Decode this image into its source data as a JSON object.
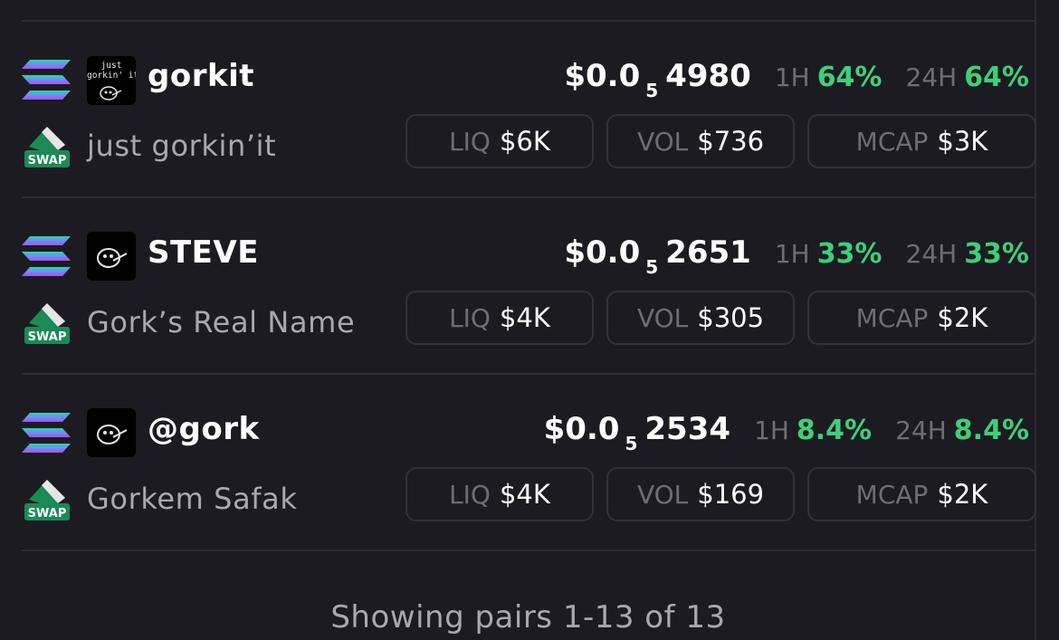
{
  "pairs": [
    {
      "symbol": "gorkit",
      "name": "just gorkin’it",
      "avatar_text": "just\ngorkin' it",
      "avatar_icon": "gork-face-icon",
      "chain_icon": "solana-icon",
      "dex_icon": "swap-eraser-icon",
      "dex_label": "SWAP",
      "price_prefix": "$0.0",
      "price_zero_count": "5",
      "price_digits": "4980",
      "h1_label": "1H",
      "h1_value": "64%",
      "h24_label": "24H",
      "h24_value": "64%",
      "liq_label": "LIQ",
      "liq_value": "$6K",
      "vol_label": "VOL",
      "vol_value": "$736",
      "mcap_label": "MCAP",
      "mcap_value": "$3K"
    },
    {
      "symbol": "STEVE",
      "name": "Gork’s Real Name",
      "avatar_text": "",
      "avatar_icon": "gork-face-icon",
      "chain_icon": "solana-icon",
      "dex_icon": "swap-eraser-icon",
      "dex_label": "SWAP",
      "price_prefix": "$0.0",
      "price_zero_count": "5",
      "price_digits": "2651",
      "h1_label": "1H",
      "h1_value": "33%",
      "h24_label": "24H",
      "h24_value": "33%",
      "liq_label": "LIQ",
      "liq_value": "$4K",
      "vol_label": "VOL",
      "vol_value": "$305",
      "mcap_label": "MCAP",
      "mcap_value": "$2K"
    },
    {
      "symbol": "@gork",
      "name": "Gorkem Safak",
      "avatar_text": "",
      "avatar_icon": "gork-face-icon",
      "chain_icon": "solana-icon",
      "dex_icon": "swap-eraser-icon",
      "dex_label": "SWAP",
      "price_prefix": "$0.0",
      "price_zero_count": "5",
      "price_digits": "2534",
      "h1_label": "1H",
      "h1_value": "8.4%",
      "h24_label": "24H",
      "h24_value": "8.4%",
      "liq_label": "LIQ",
      "liq_value": "$4K",
      "vol_label": "VOL",
      "vol_value": "$169",
      "mcap_label": "MCAP",
      "mcap_value": "$2K"
    }
  ],
  "footer": {
    "text": "Showing pairs 1-13 of 13"
  },
  "colors": {
    "background": "#1c1b21",
    "positive": "#3fcf7a",
    "muted_label": "#6e6d75",
    "token_name": "#a9a8b0",
    "border": "#33323a",
    "solana_top": "#27d7b0",
    "solana_mid": "#6c8ff2",
    "solana_bottom": "#b34cf5",
    "swap_green": "#1b8a55"
  }
}
